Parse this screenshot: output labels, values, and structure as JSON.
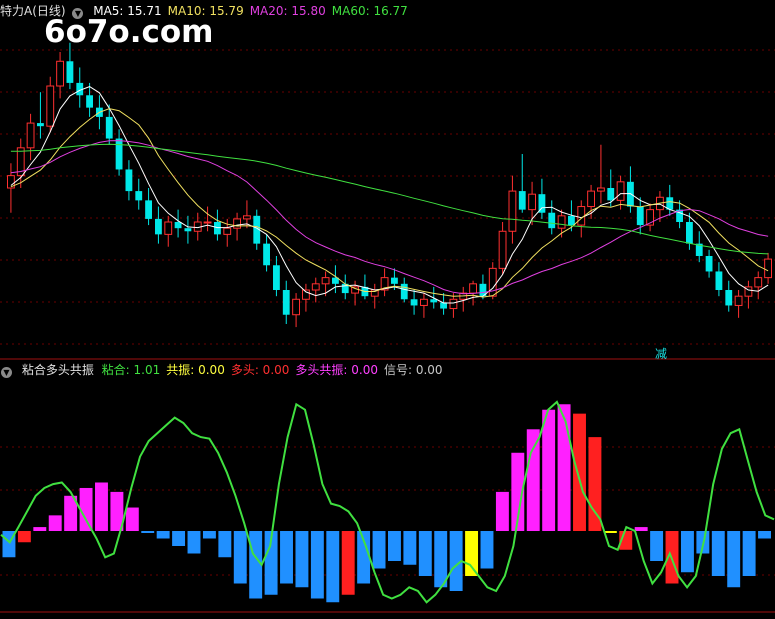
{
  "main_panel": {
    "title": "特力A(日线)",
    "indicators": [
      {
        "label": "MA5:",
        "value": "15.71",
        "color": "#ffffff"
      },
      {
        "label": "MA10:",
        "value": "15.79",
        "color": "#f0e060"
      },
      {
        "label": "MA20:",
        "value": "15.80",
        "color": "#e040e0"
      },
      {
        "label": "MA60:",
        "value": "16.77",
        "color": "#40e040"
      }
    ],
    "watermark": "6o7o.com",
    "signal_label": "减",
    "colors": {
      "up": "#ff3030",
      "down": "#00e8e8",
      "ma5": "#ffffff",
      "ma10": "#f0e060",
      "ma20": "#e040e0",
      "ma60": "#40e040"
    }
  },
  "sub_panel": {
    "title": "粘合多头共振",
    "indicators": [
      {
        "label": "粘合:",
        "value": "1.01",
        "color": "#40e040"
      },
      {
        "label": "共振:",
        "value": "0.00",
        "color": "#ffff40"
      },
      {
        "label": "多头:",
        "value": "0.00",
        "color": "#ff3030"
      },
      {
        "label": "多头共振:",
        "value": "0.00",
        "color": "#ff40ff"
      },
      {
        "label": "信号:",
        "value": "0.00",
        "color": "#c8c8c8"
      }
    ],
    "colors": {
      "line": "#40e040",
      "negative": "#2090ff",
      "positive": "#ff20ff",
      "red": "#ff2020",
      "yellow": "#ffff00"
    }
  },
  "chart_data": [
    {
      "type": "candlestick",
      "title": "特力A(日线)",
      "ylim": [
        10.5,
        21.5
      ],
      "ohlc": [
        [
          16.0,
          16.8,
          15.2,
          16.4
        ],
        [
          16.4,
          17.6,
          16.0,
          17.3
        ],
        [
          17.3,
          18.4,
          16.9,
          18.1
        ],
        [
          18.1,
          19.1,
          17.6,
          18.0
        ],
        [
          18.0,
          19.6,
          17.8,
          19.3
        ],
        [
          19.3,
          20.4,
          18.9,
          20.1
        ],
        [
          20.1,
          20.7,
          19.2,
          19.4
        ],
        [
          19.4,
          19.9,
          18.6,
          19.0
        ],
        [
          19.0,
          19.4,
          18.3,
          18.6
        ],
        [
          18.6,
          19.0,
          17.9,
          18.3
        ],
        [
          18.3,
          18.7,
          17.4,
          17.6
        ],
        [
          17.6,
          17.9,
          16.4,
          16.6
        ],
        [
          16.6,
          16.9,
          15.6,
          15.9
        ],
        [
          15.9,
          16.3,
          15.3,
          15.6
        ],
        [
          15.6,
          16.0,
          14.8,
          15.0
        ],
        [
          15.0,
          15.4,
          14.2,
          14.5
        ],
        [
          14.5,
          15.1,
          14.1,
          14.9
        ],
        [
          14.9,
          15.3,
          14.4,
          14.7
        ],
        [
          14.7,
          15.1,
          14.2,
          14.6
        ],
        [
          14.6,
          15.2,
          14.3,
          14.9
        ],
        [
          14.9,
          15.4,
          14.6,
          14.9
        ],
        [
          14.9,
          15.3,
          14.3,
          14.5
        ],
        [
          14.5,
          15.0,
          14.1,
          14.7
        ],
        [
          14.7,
          15.2,
          14.3,
          15.0
        ],
        [
          15.0,
          15.6,
          14.7,
          15.1
        ],
        [
          15.1,
          15.3,
          14.0,
          14.2
        ],
        [
          14.2,
          14.5,
          13.3,
          13.5
        ],
        [
          13.5,
          13.8,
          12.5,
          12.7
        ],
        [
          12.7,
          13.0,
          11.6,
          11.9
        ],
        [
          11.9,
          12.6,
          11.5,
          12.4
        ],
        [
          12.4,
          12.9,
          12.0,
          12.7
        ],
        [
          12.7,
          13.1,
          12.3,
          12.9
        ],
        [
          12.9,
          13.3,
          12.5,
          13.1
        ],
        [
          13.1,
          13.5,
          12.6,
          12.9
        ],
        [
          12.9,
          13.2,
          12.4,
          12.6
        ],
        [
          12.6,
          13.0,
          12.2,
          12.8
        ],
        [
          12.8,
          13.2,
          12.4,
          12.5
        ],
        [
          12.5,
          12.9,
          12.1,
          12.7
        ],
        [
          12.7,
          13.4,
          12.5,
          13.1
        ],
        [
          13.1,
          13.4,
          12.7,
          12.9
        ],
        [
          12.9,
          13.1,
          12.3,
          12.4
        ],
        [
          12.4,
          12.7,
          11.9,
          12.2
        ],
        [
          12.2,
          12.6,
          11.8,
          12.4
        ],
        [
          12.4,
          12.8,
          12.1,
          12.3
        ],
        [
          12.3,
          12.6,
          11.9,
          12.1
        ],
        [
          12.1,
          12.6,
          11.8,
          12.4
        ],
        [
          12.4,
          12.8,
          12.0,
          12.6
        ],
        [
          12.6,
          13.0,
          12.2,
          12.9
        ],
        [
          12.9,
          13.2,
          12.4,
          12.5
        ],
        [
          12.5,
          13.6,
          12.4,
          13.4
        ],
        [
          13.4,
          14.9,
          13.2,
          14.6
        ],
        [
          14.6,
          16.4,
          14.2,
          15.9
        ],
        [
          15.9,
          17.1,
          15.2,
          15.3
        ],
        [
          15.3,
          16.2,
          14.8,
          15.8
        ],
        [
          15.8,
          16.3,
          15.0,
          15.2
        ],
        [
          15.2,
          15.6,
          14.5,
          14.7
        ],
        [
          14.7,
          15.3,
          14.4,
          15.1
        ],
        [
          15.1,
          15.6,
          14.6,
          14.8
        ],
        [
          14.8,
          15.6,
          14.4,
          15.4
        ],
        [
          15.4,
          16.1,
          15.0,
          15.9
        ],
        [
          15.9,
          17.4,
          15.5,
          16.0
        ],
        [
          16.0,
          16.6,
          15.4,
          15.6
        ],
        [
          15.6,
          16.4,
          15.3,
          16.2
        ],
        [
          16.2,
          16.7,
          15.2,
          15.4
        ],
        [
          15.4,
          15.7,
          14.5,
          14.8
        ],
        [
          14.8,
          15.5,
          14.6,
          15.3
        ],
        [
          15.3,
          15.9,
          14.9,
          15.7
        ],
        [
          15.7,
          16.1,
          15.1,
          15.3
        ],
        [
          15.3,
          15.6,
          14.7,
          14.9
        ],
        [
          14.9,
          15.2,
          14.0,
          14.2
        ],
        [
          14.2,
          14.6,
          13.6,
          13.8
        ],
        [
          13.8,
          14.0,
          13.1,
          13.3
        ],
        [
          13.3,
          13.6,
          12.5,
          12.7
        ],
        [
          12.7,
          13.0,
          12.0,
          12.2
        ],
        [
          12.2,
          12.7,
          11.8,
          12.5
        ],
        [
          12.5,
          13.0,
          12.1,
          12.8
        ],
        [
          12.8,
          13.3,
          12.4,
          13.1
        ],
        [
          13.1,
          13.9,
          12.9,
          13.7
        ]
      ],
      "ma_lines": [
        "MA5",
        "MA10",
        "MA20",
        "MA60"
      ]
    },
    {
      "type": "line+bar",
      "title": "粘合多头共振",
      "ylim": [
        -1.0,
        1.7
      ],
      "line_series": {
        "name": "粘合",
        "values": [
          -0.05,
          -0.15,
          0.05,
          0.25,
          0.45,
          0.55,
          0.6,
          0.62,
          0.5,
          0.3,
          0.1,
          -0.1,
          -0.35,
          -0.3,
          0.1,
          0.55,
          0.95,
          1.15,
          1.25,
          1.35,
          1.45,
          1.38,
          1.25,
          1.2,
          1.18,
          1.0,
          0.75,
          0.45,
          0.1,
          -0.3,
          -0.45,
          -0.2,
          0.6,
          1.2,
          1.62,
          1.55,
          1.1,
          0.6,
          0.35,
          0.32,
          0.25,
          0.1,
          -0.2,
          -0.55,
          -0.85,
          -0.9,
          -0.85,
          -0.75,
          -0.8,
          -0.95,
          -0.85,
          -0.7,
          -0.5,
          -0.4,
          -0.45,
          -0.6,
          -0.75,
          -0.8,
          -0.6,
          -0.2,
          0.5,
          1.0,
          1.2,
          1.55,
          1.65,
          1.4,
          0.9,
          0.5,
          0.3,
          0.15,
          -0.2,
          -0.25,
          0.05,
          0.0,
          -0.4,
          -0.7,
          -0.55,
          -0.3,
          -0.6,
          -0.75,
          -0.6,
          -0.1,
          0.6,
          1.05,
          1.25,
          1.3,
          0.9,
          0.5,
          0.2,
          0.15
        ]
      },
      "bars": [
        [
          -0.35,
          "n"
        ],
        [
          -0.15,
          "r"
        ],
        [
          0.05,
          "p"
        ],
        [
          0.2,
          "p"
        ],
        [
          0.45,
          "p"
        ],
        [
          0.55,
          "p"
        ],
        [
          0.62,
          "p"
        ],
        [
          0.5,
          "p"
        ],
        [
          0.3,
          "p"
        ],
        [
          0.0,
          "n"
        ],
        [
          -0.1,
          "n"
        ],
        [
          -0.2,
          "n"
        ],
        [
          -0.3,
          "n"
        ],
        [
          -0.1,
          "n"
        ],
        [
          -0.35,
          "n"
        ],
        [
          -0.7,
          "n"
        ],
        [
          -0.9,
          "n"
        ],
        [
          -0.85,
          "n"
        ],
        [
          -0.7,
          "n"
        ],
        [
          -0.75,
          "n"
        ],
        [
          -0.9,
          "n"
        ],
        [
          -0.95,
          "n"
        ],
        [
          -0.85,
          "r"
        ],
        [
          -0.7,
          "n"
        ],
        [
          -0.5,
          "n"
        ],
        [
          -0.4,
          "n"
        ],
        [
          -0.45,
          "n"
        ],
        [
          -0.6,
          "n"
        ],
        [
          -0.75,
          "n"
        ],
        [
          -0.8,
          "n"
        ],
        [
          -0.6,
          "y"
        ],
        [
          -0.5,
          "n"
        ],
        [
          0.5,
          "p"
        ],
        [
          1.0,
          "p"
        ],
        [
          1.3,
          "p"
        ],
        [
          1.55,
          "p"
        ],
        [
          1.62,
          "p"
        ],
        [
          1.5,
          "r"
        ],
        [
          1.2,
          "r"
        ],
        [
          0.0,
          "y"
        ],
        [
          -0.25,
          "r"
        ],
        [
          0.05,
          "p"
        ],
        [
          -0.4,
          "n"
        ],
        [
          -0.7,
          "r"
        ],
        [
          -0.55,
          "n"
        ],
        [
          -0.3,
          "n"
        ],
        [
          -0.6,
          "n"
        ],
        [
          -0.75,
          "n"
        ],
        [
          -0.6,
          "n"
        ],
        [
          -0.1,
          "n"
        ]
      ]
    }
  ]
}
